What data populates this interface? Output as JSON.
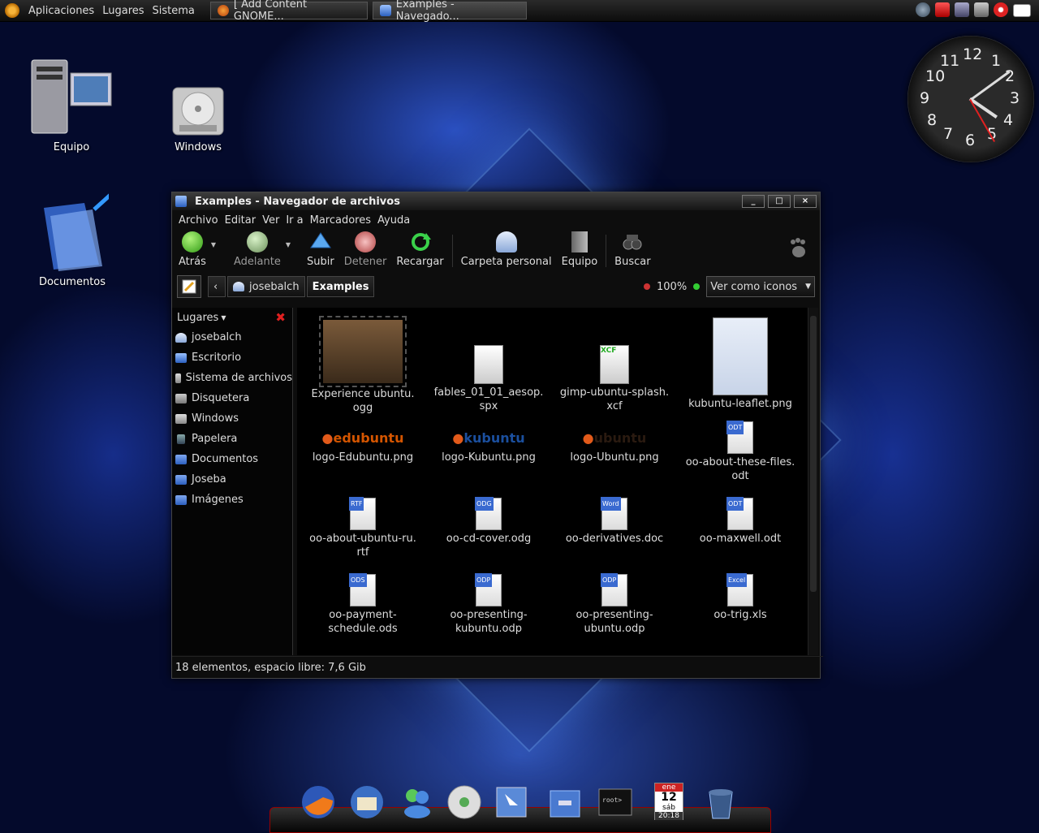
{
  "panel": {
    "menus": [
      "Aplicaciones",
      "Lugares",
      "Sistema"
    ],
    "tasks": [
      {
        "label": "[ Add Content GNOME...",
        "icon": "firefox-icon"
      },
      {
        "label": "Examples - Navegado...",
        "icon": "folder-icon"
      }
    ],
    "tray_icons": [
      "network-icon",
      "update-icon",
      "computer-icon",
      "volume-icon",
      "power-icon",
      "show-desktop-icon"
    ]
  },
  "desktop": {
    "icons": [
      {
        "label": "Equipo",
        "icon": "computer-icon"
      },
      {
        "label": "Windows",
        "icon": "harddisk-icon"
      },
      {
        "label": "Documentos",
        "icon": "folder-icon"
      }
    ],
    "clock": {
      "numbers": [
        "12",
        "1",
        "2",
        "3",
        "4",
        "5",
        "6",
        "7",
        "8",
        "9",
        "10",
        "11"
      ],
      "time_hours": 4,
      "time_minutes": 9
    }
  },
  "window": {
    "title": "Examples - Navegador de archivos",
    "controls": [
      "_",
      "□",
      "×"
    ],
    "menu": [
      "Archivo",
      "Editar",
      "Ver",
      "Ir a",
      "Marcadores",
      "Ayuda"
    ],
    "toolbar": {
      "back": "Atrás",
      "forward": "Adelante",
      "up": "Subir",
      "stop": "Detener",
      "reload": "Recargar",
      "home": "Carpeta personal",
      "computer": "Equipo",
      "search": "Buscar"
    },
    "location": {
      "crumbs": [
        "josebalch",
        "Examples"
      ],
      "zoom": "100%",
      "view": "Ver como iconos"
    },
    "sidebar": {
      "header": "Lugares",
      "places": [
        "josebalch",
        "Escritorio",
        "Sistema de archivos",
        "Disquetera",
        "Windows",
        "Papelera",
        "Documentos",
        "Joseba",
        "Imágenes"
      ]
    },
    "files": [
      {
        "name": "Experience ubuntu.",
        "name2": "ogg",
        "kind": "video"
      },
      {
        "name": "fables_01_01_aesop.",
        "name2": "spx",
        "kind": "audio"
      },
      {
        "name": "gimp-ubuntu-splash.",
        "name2": "xcf",
        "kind": "xcf",
        "tag": "XCF"
      },
      {
        "name": "kubuntu-leaflet.png",
        "name2": "",
        "kind": "leaflet"
      },
      {
        "name": "logo-Edubuntu.png",
        "name2": "",
        "kind": "logo",
        "logo_text": "edubuntu"
      },
      {
        "name": "logo-Kubuntu.png",
        "name2": "",
        "kind": "logo",
        "logo_text": "kubuntu"
      },
      {
        "name": "logo-Ubuntu.png",
        "name2": "",
        "kind": "logo",
        "logo_text": "ubuntu"
      },
      {
        "name": "oo-about-these-files.",
        "name2": "odt",
        "kind": "doc",
        "tag": "ODT"
      },
      {
        "name": "oo-about-ubuntu-ru.",
        "name2": "rtf",
        "kind": "doc",
        "tag": "RTF"
      },
      {
        "name": "oo-cd-cover.odg",
        "name2": "",
        "kind": "doc",
        "tag": "ODG"
      },
      {
        "name": "oo-derivatives.doc",
        "name2": "",
        "kind": "doc",
        "tag": "Word"
      },
      {
        "name": "oo-maxwell.odt",
        "name2": "",
        "kind": "doc",
        "tag": "ODT"
      },
      {
        "name": "oo-payment-",
        "name2": "schedule.ods",
        "kind": "doc",
        "tag": "ODS"
      },
      {
        "name": "oo-presenting-",
        "name2": "kubuntu.odp",
        "kind": "doc",
        "tag": "ODP"
      },
      {
        "name": "oo-presenting-",
        "name2": "ubuntu.odp",
        "kind": "doc",
        "tag": "ODP"
      },
      {
        "name": "oo-trig.xls",
        "name2": "",
        "kind": "doc",
        "tag": "Excel"
      }
    ],
    "status": "18 elementos, espacio libre: 7,6 Gib"
  },
  "dock": {
    "items": [
      "firefox-icon",
      "thunderbird-icon",
      "messenger-icon",
      "music-player-icon",
      "window-icon",
      "file-manager-icon",
      "terminal-icon",
      "calendar-icon",
      "trash-icon"
    ],
    "calendar": {
      "month": "ene",
      "day": "12",
      "weekday": "sáb",
      "time": "20:18"
    }
  },
  "colors": {
    "accent": "#2b5fbf",
    "close_red": "#e02020",
    "background": "#040a2c"
  }
}
